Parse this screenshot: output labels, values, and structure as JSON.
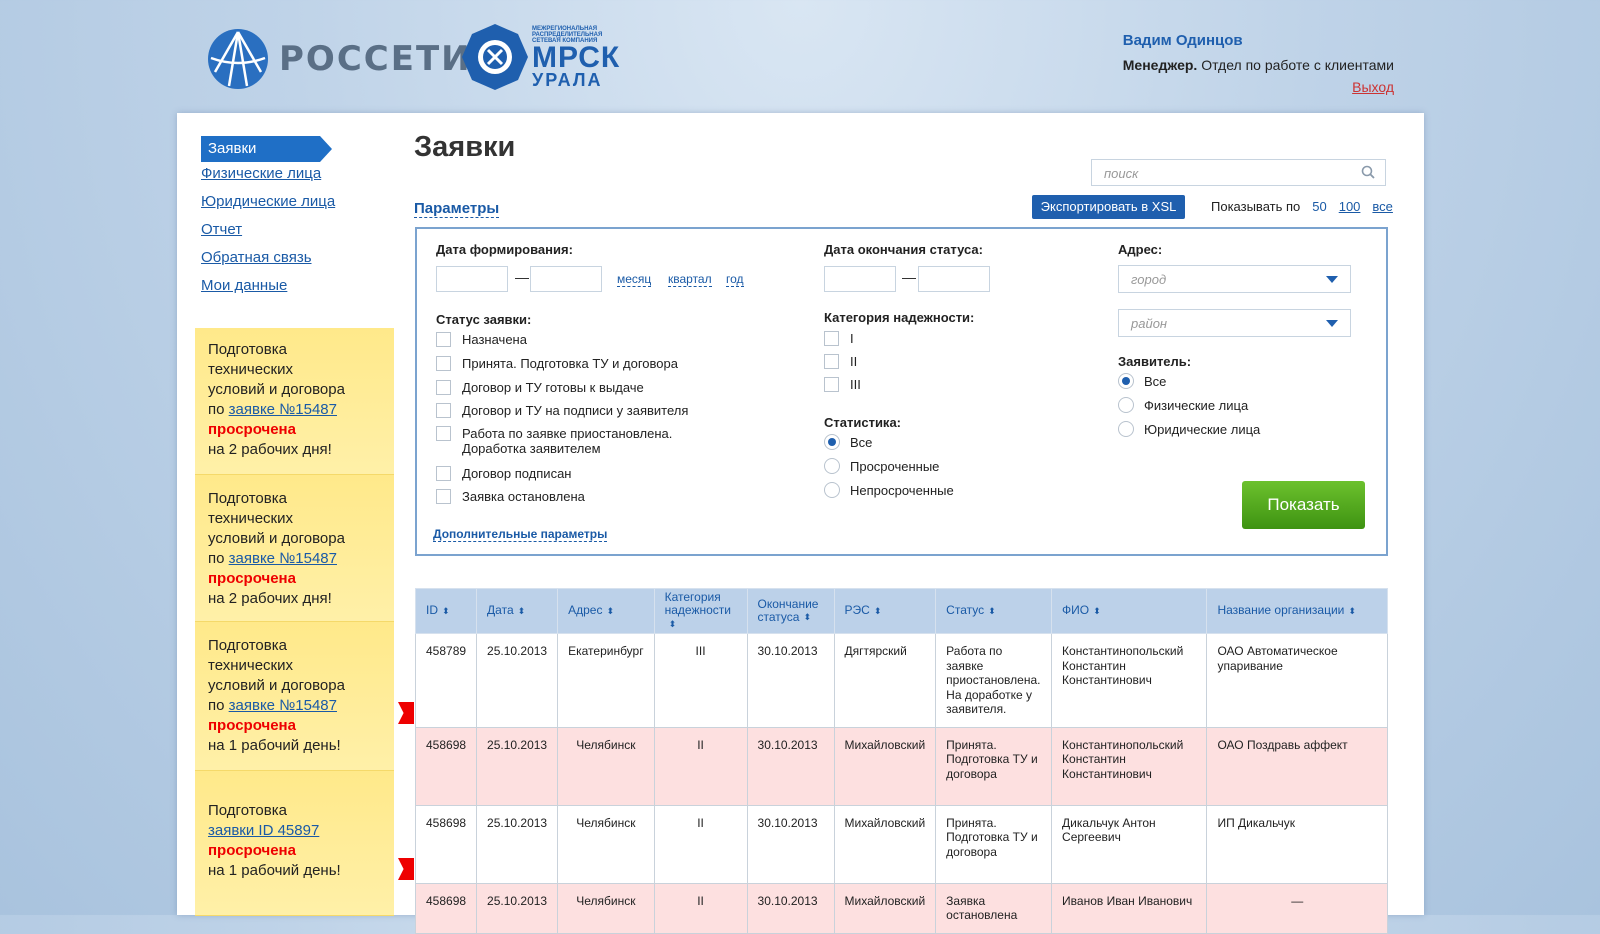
{
  "header": {
    "logo1_text": "РОССЕТИ",
    "logo2_small": "МЕЖРЕГИОНАЛЬНАЯ РАСПРЕДЕЛИТЕЛЬНАЯ СЕТЕВАЯ КОМПАНИЯ",
    "logo2_big": "МРСК",
    "logo2_big2": "УРАЛА",
    "user_name": "Вадим Одинцов",
    "user_role_bold": "Менеджер.",
    "user_role": "Отдел по работе с клиентами",
    "logout": "Выход"
  },
  "nav": {
    "active": "Заявки",
    "items": [
      "Физические лица",
      "Юридические лица",
      "Отчет",
      "Обратная связь",
      "Мои данные"
    ]
  },
  "notes": [
    {
      "l1": "Подготовка",
      "l2": "технических",
      "l3": "условий и договора",
      "pre": "по ",
      "link": "заявке №15487",
      "overdue": "просрочена",
      "tail": "на 2 рабочих дня!"
    },
    {
      "l1": "Подготовка",
      "l2": "технических",
      "l3": "условий и договора",
      "pre": "по ",
      "link": "заявке №15487",
      "overdue": "просрочена",
      "tail": "на 2 рабочих дня!"
    },
    {
      "l1": "Подготовка",
      "l2": "технических",
      "l3": "условий и договора",
      "pre": "по ",
      "link": "заявке №15487",
      "overdue": "просрочена",
      "tail": "на 1 рабочий день!"
    },
    {
      "l1": "Подготовка",
      "link": "заявки ID 45897",
      "overdue": "просрочена",
      "tail": "на 1 рабочий день!"
    }
  ],
  "main": {
    "title": "Заявки",
    "search_placeholder": "поиск",
    "params_link": "Параметры",
    "export_button": "Экспортировать в XSL",
    "showby_label": "Показывать по",
    "showby_options": [
      "50",
      "100",
      "все"
    ]
  },
  "filters": {
    "date_form_label": "Дата формирования:",
    "periods": [
      "месяц",
      "квартал",
      "год"
    ],
    "date_end_label": "Дата окончания статуса:",
    "address_label": "Адрес:",
    "city_placeholder": "город",
    "district_placeholder": "район",
    "status_label": "Статус заявки:",
    "statuses": [
      "Назначена",
      "Принята. Подготовка ТУ и договора",
      "Договор и ТУ готовы к выдаче",
      "Договор и ТУ на подписи у заявителя",
      "Работа по заявке приостановлена.",
      "Договор подписан",
      "Заявка остановлена"
    ],
    "status5_line2": "Доработка заявителем",
    "reliability_label": "Категория надежности:",
    "reliability": [
      "I",
      "II",
      "III"
    ],
    "stats_label": "Статистика:",
    "stats": [
      "Все",
      "Просроченные",
      "Непросроченные"
    ],
    "applicant_label": "Заявитель:",
    "applicant": [
      "Все",
      "Физические лица",
      "Юридические лица"
    ],
    "more_link": "Дополнительные параметры",
    "show_button": "Показать"
  },
  "table": {
    "headers": [
      "ID",
      "Дата",
      "Адрес",
      "Категория надежности",
      "Окончание статуса",
      "РЭС",
      "Статус",
      "ФИО",
      "Название организации"
    ],
    "rows": [
      {
        "id": "458789",
        "date": "25.10.2013",
        "addr": "Екатеринбург",
        "cat": "III",
        "end": "30.10.2013",
        "res": "Дягтярский",
        "status": "Работа по заявке приостановлена. На доработке у заявителя.",
        "fio": "Константинопольский Константин Константинович",
        "org": "ОАО Автоматическое упаривание"
      },
      {
        "id": "458698",
        "date": "25.10.2013",
        "addr": "Челябинск",
        "cat": "II",
        "end": "30.10.2013",
        "res": "Михайловский",
        "status": "Принята. Подготовка ТУ и договора",
        "fio": "Константинопольский Константин Константинович",
        "org": "ОАО Поздравь аффект"
      },
      {
        "id": "458698",
        "date": "25.10.2013",
        "addr": "Челябинск",
        "cat": "II",
        "end": "30.10.2013",
        "res": "Михайловский",
        "status": "Принята. Подготовка ТУ и договора",
        "fio": "Дикальчук Антон Сергеевич",
        "org": "ИП Дикальчук"
      },
      {
        "id": "458698",
        "date": "25.10.2013",
        "addr": "Челябинск",
        "cat": "II",
        "end": "30.10.2013",
        "res": "Михайловский",
        "status": "Заявка остановлена",
        "fio": "Иванов Иван Иванович",
        "org": "—"
      }
    ]
  },
  "colors": {
    "accent": "#1f5fae",
    "green": "#4fa61c",
    "overdue": "#e00000",
    "note_bg": "#ffe98a",
    "row_pink": "#fde0e0"
  }
}
